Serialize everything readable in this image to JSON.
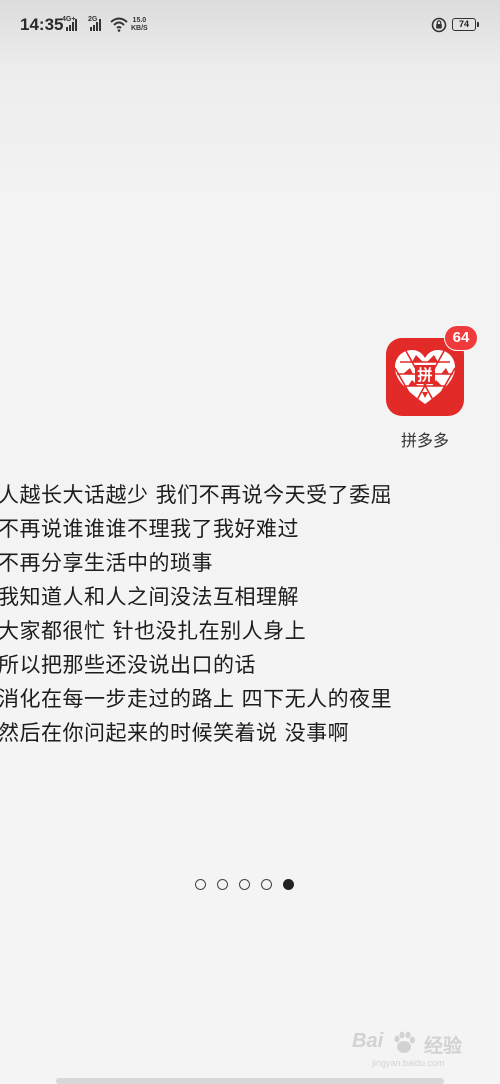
{
  "status_bar": {
    "time": "14:35",
    "network_1": "4G+",
    "network_2": "2G",
    "speed_value": "15.0",
    "speed_unit": "KB/S",
    "battery": "74"
  },
  "app": {
    "name": "拼多多",
    "badge": "64",
    "brand_color": "#e22a28"
  },
  "lyrics": [
    "人越长大话越少 我们不再说今天受了委屈",
    "不再说谁谁谁不理我了我好难过",
    "不再分享生活中的琐事",
    "我知道人和人之间没法互相理解",
    "大家都很忙 针也没扎在别人身上",
    "所以把那些还没说出口的话",
    "消化在每一步走过的路上 四下无人的夜里",
    "然后在你问起来的时候笑着说 没事啊"
  ],
  "pager": {
    "total": 5,
    "active_index": 4
  },
  "watermark": {
    "brand_prefix": "Bai",
    "brand_suffix": "经验",
    "url": "jingyan.baidu.com"
  }
}
